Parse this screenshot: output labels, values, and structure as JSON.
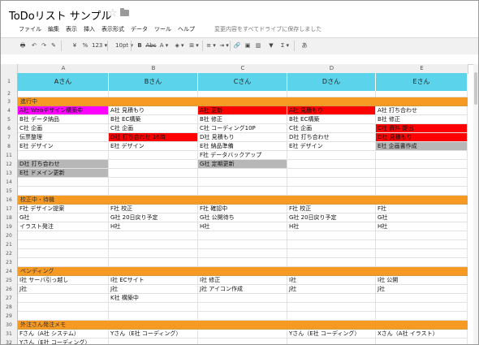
{
  "title": {
    "doc_name": "ToDoリスト サンプル",
    "star_icon": "star-icon",
    "folder_icon": "folder-icon"
  },
  "menu": [
    "ファイル",
    "編集",
    "表示",
    "挿入",
    "表示形式",
    "データ",
    "ツール",
    "ヘルプ"
  ],
  "save_status": "変更内容をすべてドライブに保存しました",
  "toolbar": {
    "items": [
      {
        "name": "print-icon",
        "label": "🖶"
      },
      {
        "name": "undo-icon",
        "label": "↶"
      },
      {
        "name": "redo-icon",
        "label": "↷"
      },
      {
        "name": "paint-format-icon",
        "label": "✎"
      },
      {
        "name": "currency-icon",
        "label": "¥"
      },
      {
        "name": "percent-icon",
        "label": "%"
      },
      {
        "name": "number-format-label",
        "label": "123 ▾"
      },
      {
        "name": "font-size-label",
        "label": "10pt ▾"
      },
      {
        "name": "bold-icon",
        "label": "B"
      },
      {
        "name": "strikethrough-icon",
        "label": "Abc"
      },
      {
        "name": "text-color-icon",
        "label": "A ▾"
      },
      {
        "name": "fill-color-icon",
        "label": "◈ ▾"
      },
      {
        "name": "borders-icon",
        "label": "⊞ ▾"
      },
      {
        "name": "align-icon",
        "label": "≡ ▾"
      },
      {
        "name": "wrap-icon",
        "label": "⇥ ▾"
      },
      {
        "name": "link-icon",
        "label": "🔗"
      },
      {
        "name": "comment-icon",
        "label": "▣"
      },
      {
        "name": "chart-icon",
        "label": "▥"
      },
      {
        "name": "filter-icon",
        "label": "▼"
      },
      {
        "name": "functions-icon",
        "label": "Σ ▾"
      },
      {
        "name": "input-tools-icon",
        "label": "あ"
      }
    ]
  },
  "colors": {
    "header_cyan": "#5bd3eb",
    "section_orange": "#f79a24",
    "magenta": "#ff00ff",
    "red": "#ff0000",
    "gray": "#b7b7b7"
  },
  "columns": [
    "A",
    "B",
    "C",
    "D",
    "E"
  ],
  "row_numbers": [
    "1",
    "2",
    "3",
    "4",
    "5",
    "6",
    "7",
    "8",
    "11",
    "12",
    "13",
    "14",
    "15",
    "16",
    "17",
    "18",
    "19",
    "20",
    "21",
    "22",
    "23",
    "24",
    "25",
    "26",
    "27",
    "28",
    "29",
    "30",
    "31",
    "32",
    "33"
  ],
  "header_row": [
    "Aさん",
    "Bさん",
    "Cさん",
    "Dさん",
    "Eさん"
  ],
  "sections": {
    "in_progress": "進行中",
    "proof": "校正中・待機",
    "pending": "ペンディング",
    "outsourcing": "外注さん発注メモ"
  },
  "rows": {
    "r3": [
      "A社 Webデザイン構築中",
      "A社 見積もり",
      "A社 更新",
      "A社 見積もり",
      "A社 打ち合わせ"
    ],
    "r4": [
      "B社 データ納品",
      "B社 EC構築",
      "B社 修正",
      "B社 EC構築",
      "B社 修正"
    ],
    "r5": [
      "C社 企画",
      "C社 企画",
      "C社 コーディング10P",
      "C社 企画",
      "C社 資料 提出"
    ],
    "r6": [
      "伝票整理",
      "D社 打ち合わせ 16時",
      "D社 見積もり",
      "D社 打ち合わせ",
      "D社 見積もり"
    ],
    "r7": [
      "E社 デザイン",
      "E社 デザイン",
      "E社 納品準備",
      "E社 デザイン",
      "E社 企画書作成"
    ],
    "r8": [
      "",
      "",
      "F社 データバックアップ",
      "",
      ""
    ],
    "r11": [
      "D社 打ち合わせ",
      "",
      "G社 定期更新",
      "",
      ""
    ],
    "r12": [
      "E社 ドメイン更新",
      "",
      "",
      "",
      ""
    ],
    "r16": [
      "F社 デザイン提案",
      "F社 校正",
      "F社 確認中",
      "F社 校正",
      "F社"
    ],
    "r17": [
      "G社",
      "G社 20日戻り予定",
      "G社 公開待ち",
      "G社 20日戻り予定",
      "G社"
    ],
    "r18": [
      "イラスト発注",
      "H社",
      "H社",
      "H社",
      "H社"
    ],
    "r24": [
      "I社 サーバ引っ越し",
      "I社 ECサイト",
      "I社 修正",
      "I社",
      "I社 公開"
    ],
    "r25": [
      "J社",
      "J社",
      "J社 アイコン作成",
      "J社",
      "J社"
    ],
    "r26": [
      "",
      "K社 構築中",
      "",
      "",
      ""
    ],
    "r31": [
      "Fさん（A社 システム）",
      "Yさん（E社 コーディング）",
      "",
      "Yさん（E社 コーディング）",
      "Xさん（A社 イラスト）"
    ],
    "r32": [
      "Yさん（E社 コーディング）",
      "",
      "",
      "",
      ""
    ]
  }
}
